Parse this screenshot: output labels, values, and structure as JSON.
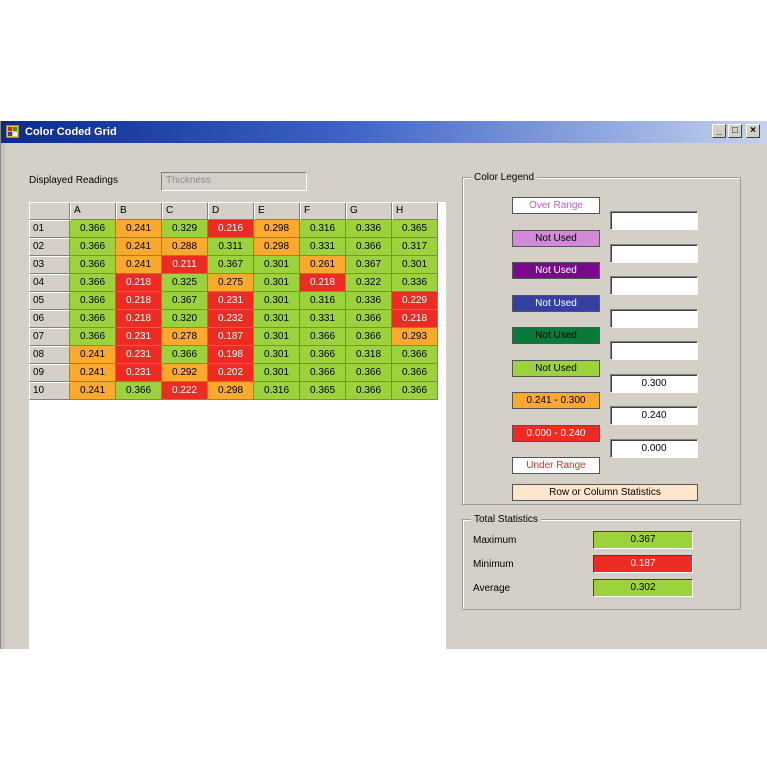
{
  "window": {
    "title": "Color Coded Grid",
    "buttons": {
      "minimize": "_",
      "maximize": "□",
      "close": "×"
    }
  },
  "readings": {
    "label": "Displayed Readings",
    "value": "Thickness"
  },
  "grid": {
    "columns": [
      "A",
      "B",
      "C",
      "D",
      "E",
      "F",
      "G",
      "H"
    ],
    "rows": [
      {
        "label": "01",
        "cells": [
          [
            "0.366",
            "g"
          ],
          [
            "0.241",
            "o"
          ],
          [
            "0.329",
            "g"
          ],
          [
            "0.216",
            "r"
          ],
          [
            "0.298",
            "o"
          ],
          [
            "0.316",
            "g"
          ],
          [
            "0.336",
            "g"
          ],
          [
            "0.365",
            "g"
          ]
        ]
      },
      {
        "label": "02",
        "cells": [
          [
            "0.366",
            "g"
          ],
          [
            "0.241",
            "o"
          ],
          [
            "0.288",
            "o"
          ],
          [
            "0.311",
            "g"
          ],
          [
            "0.298",
            "o"
          ],
          [
            "0.331",
            "g"
          ],
          [
            "0.366",
            "g"
          ],
          [
            "0.317",
            "g"
          ]
        ]
      },
      {
        "label": "03",
        "cells": [
          [
            "0.366",
            "g"
          ],
          [
            "0.241",
            "o"
          ],
          [
            "0.211",
            "r"
          ],
          [
            "0.367",
            "g"
          ],
          [
            "0.301",
            "g"
          ],
          [
            "0.261",
            "o"
          ],
          [
            "0.367",
            "g"
          ],
          [
            "0.301",
            "g"
          ]
        ]
      },
      {
        "label": "04",
        "cells": [
          [
            "0.366",
            "g"
          ],
          [
            "0.218",
            "r"
          ],
          [
            "0.325",
            "g"
          ],
          [
            "0.275",
            "o"
          ],
          [
            "0.301",
            "g"
          ],
          [
            "0.218",
            "r"
          ],
          [
            "0.322",
            "g"
          ],
          [
            "0.336",
            "g"
          ]
        ]
      },
      {
        "label": "05",
        "cells": [
          [
            "0.366",
            "g"
          ],
          [
            "0.218",
            "r"
          ],
          [
            "0.367",
            "g"
          ],
          [
            "0.231",
            "r"
          ],
          [
            "0.301",
            "g"
          ],
          [
            "0.316",
            "g"
          ],
          [
            "0.336",
            "g"
          ],
          [
            "0.229",
            "r"
          ]
        ]
      },
      {
        "label": "06",
        "cells": [
          [
            "0.366",
            "g"
          ],
          [
            "0.218",
            "r"
          ],
          [
            "0.320",
            "g"
          ],
          [
            "0.232",
            "r"
          ],
          [
            "0.301",
            "g"
          ],
          [
            "0.331",
            "g"
          ],
          [
            "0.366",
            "g"
          ],
          [
            "0.218",
            "r"
          ]
        ]
      },
      {
        "label": "07",
        "cells": [
          [
            "0.366",
            "g"
          ],
          [
            "0.231",
            "r"
          ],
          [
            "0.278",
            "o"
          ],
          [
            "0.187",
            "r"
          ],
          [
            "0.301",
            "g"
          ],
          [
            "0.366",
            "g"
          ],
          [
            "0.366",
            "g"
          ],
          [
            "0.293",
            "o"
          ]
        ]
      },
      {
        "label": "08",
        "cells": [
          [
            "0.241",
            "o"
          ],
          [
            "0.231",
            "r"
          ],
          [
            "0.366",
            "g"
          ],
          [
            "0.198",
            "r"
          ],
          [
            "0.301",
            "g"
          ],
          [
            "0.366",
            "g"
          ],
          [
            "0.318",
            "g"
          ],
          [
            "0.366",
            "g"
          ]
        ]
      },
      {
        "label": "09",
        "cells": [
          [
            "0.241",
            "o"
          ],
          [
            "0.231",
            "r"
          ],
          [
            "0.292",
            "o"
          ],
          [
            "0.202",
            "r"
          ],
          [
            "0.301",
            "g"
          ],
          [
            "0.366",
            "g"
          ],
          [
            "0.366",
            "g"
          ],
          [
            "0.366",
            "g"
          ]
        ]
      },
      {
        "label": "10",
        "cells": [
          [
            "0.241",
            "o"
          ],
          [
            "0.366",
            "g"
          ],
          [
            "0.222",
            "r"
          ],
          [
            "0.298",
            "o"
          ],
          [
            "0.316",
            "g"
          ],
          [
            "0.365",
            "g"
          ],
          [
            "0.366",
            "g"
          ],
          [
            "0.366",
            "g"
          ]
        ]
      }
    ]
  },
  "legend": {
    "title": "Color Legend",
    "items": [
      {
        "label": "Over Range",
        "bg": "#ffffff",
        "fg": "#c060c0"
      },
      {
        "label": "Not Used",
        "bg": "#d08ad6",
        "fg": "#000000"
      },
      {
        "label": "Not Used",
        "bg": "#7a0a8c",
        "fg": "#ffffff"
      },
      {
        "label": "Not Used",
        "bg": "#3540a0",
        "fg": "#ffffff"
      },
      {
        "label": "Not Used",
        "bg": "#0a7a3a",
        "fg": "#000000"
      },
      {
        "label": "Not Used",
        "bg": "#9cd33c",
        "fg": "#000000"
      },
      {
        "label": "0.241 - 0.300",
        "bg": "#f9a92c",
        "fg": "#000000"
      },
      {
        "label": "0.000 - 0.240",
        "bg": "#ee2b22",
        "fg": "#ffffff"
      },
      {
        "label": "Under Range",
        "bg": "#ffffff",
        "fg": "#e0301e"
      }
    ],
    "fields": [
      "",
      "",
      "",
      "",
      "",
      "0.300",
      "0.240",
      "0.000"
    ],
    "stats_button": "Row or Column Statistics"
  },
  "total_stats": {
    "title": "Total Statistics",
    "maximum_label": "Maximum",
    "maximum_value": "0.367",
    "minimum_label": "Minimum",
    "minimum_value": "0.187",
    "average_label": "Average",
    "average_value": "0.302"
  },
  "colors": {
    "green": "#9cd33c",
    "orange": "#f9a92c",
    "red": "#ee2b22",
    "stats_bg": "#fde6cc"
  }
}
